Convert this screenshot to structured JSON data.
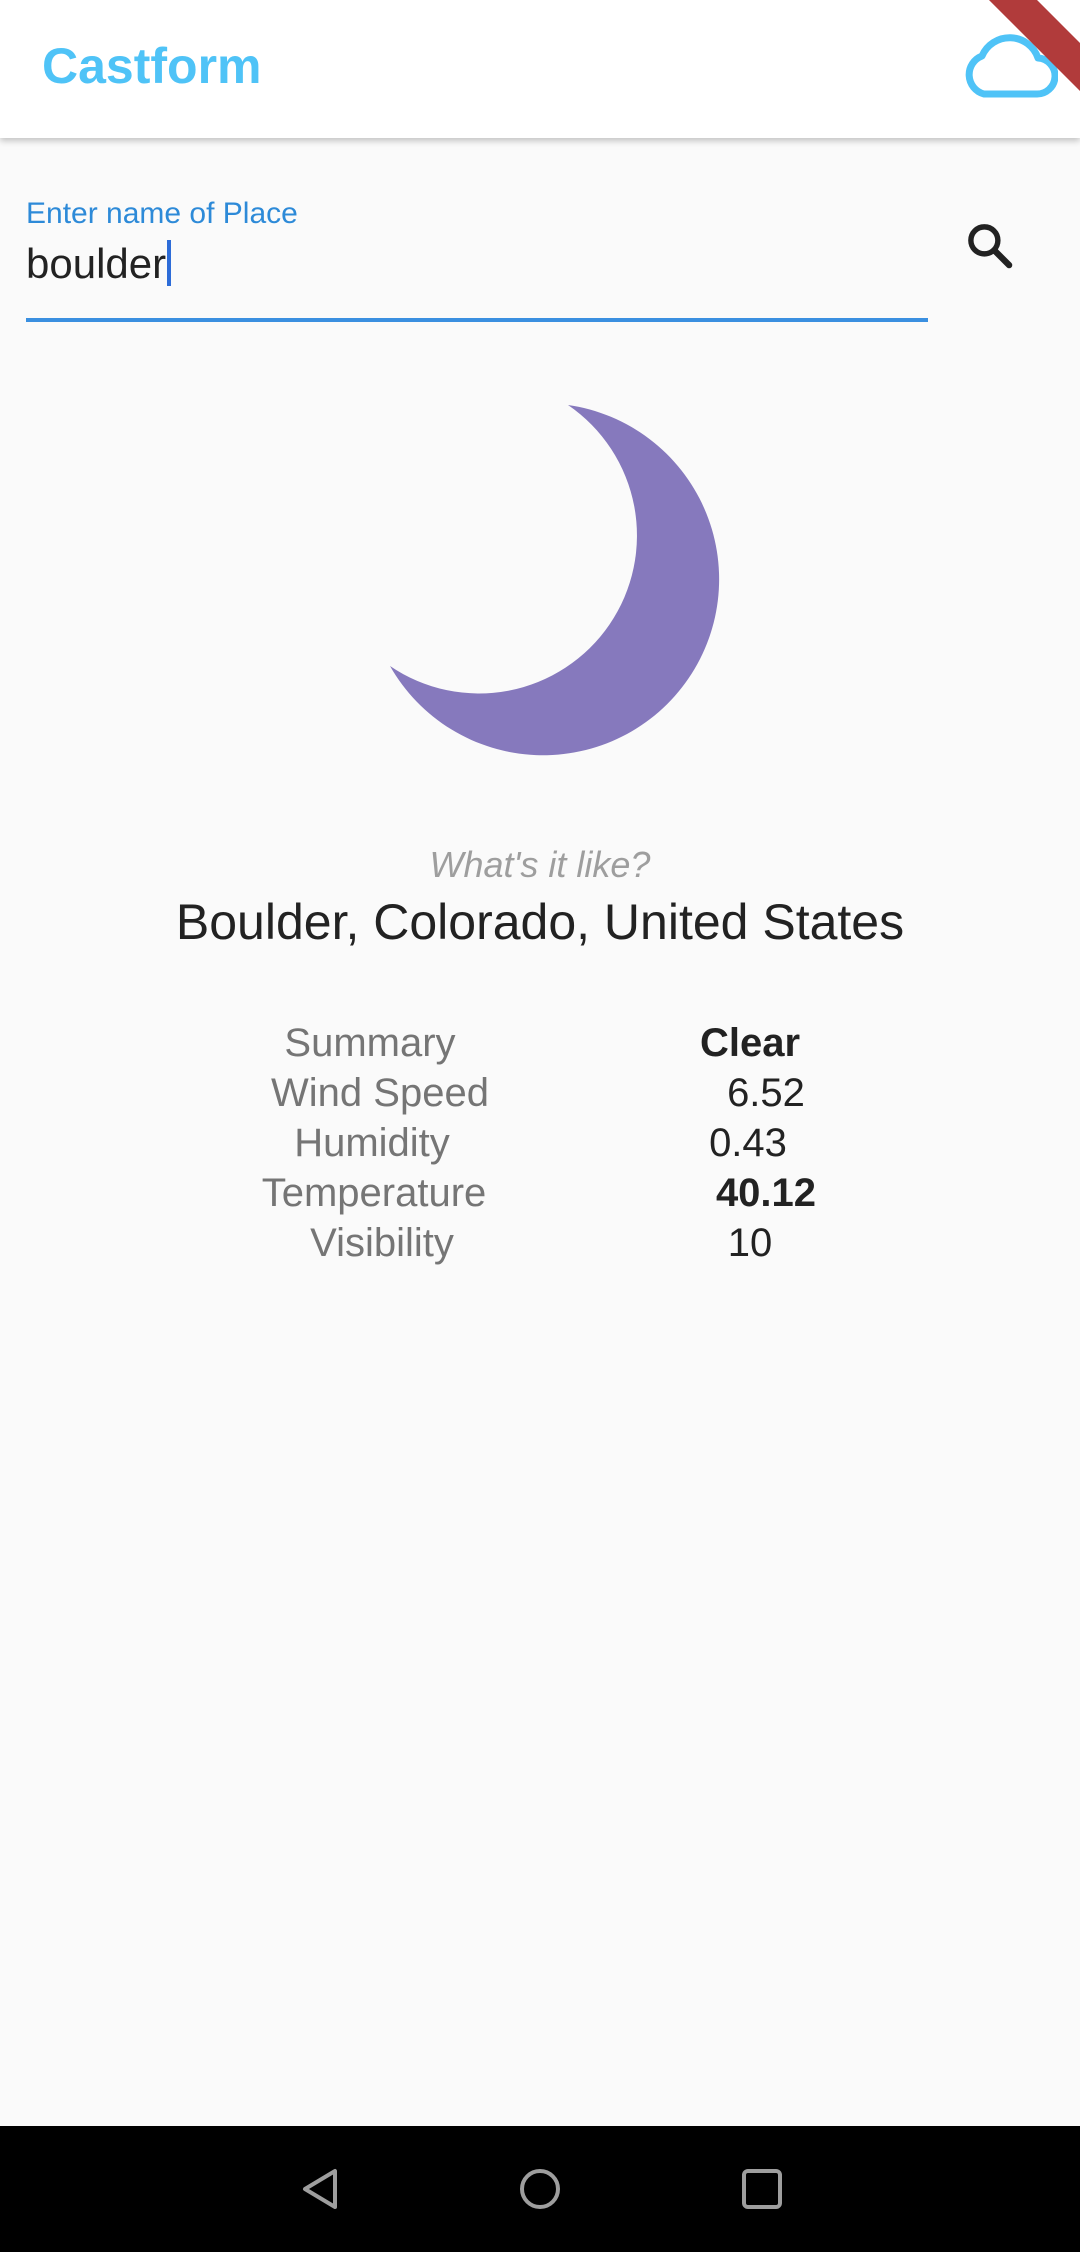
{
  "app": {
    "title": "Castform",
    "title_color": "#4fc3f7",
    "appbar_icon": "cloud-icon"
  },
  "search": {
    "label": "Enter name of Place",
    "value": "boulder",
    "accent": "#2d8ad8",
    "button_icon": "search-icon"
  },
  "weather": {
    "icon": "moon-icon",
    "icon_color": "#8679bd",
    "subtitle": "What's it like?",
    "place": "Boulder, Colorado, United States",
    "details": [
      {
        "label": "Summary",
        "value": "Clear"
      },
      {
        "label": "Wind Speed",
        "value": "6.52"
      },
      {
        "label": "Humidity",
        "value": "0.43"
      },
      {
        "label": "Temperature",
        "value": "40.12"
      },
      {
        "label": "Visibility",
        "value": "10"
      }
    ]
  },
  "navbar": {
    "buttons": [
      "back-icon",
      "home-icon",
      "recents-icon"
    ]
  }
}
